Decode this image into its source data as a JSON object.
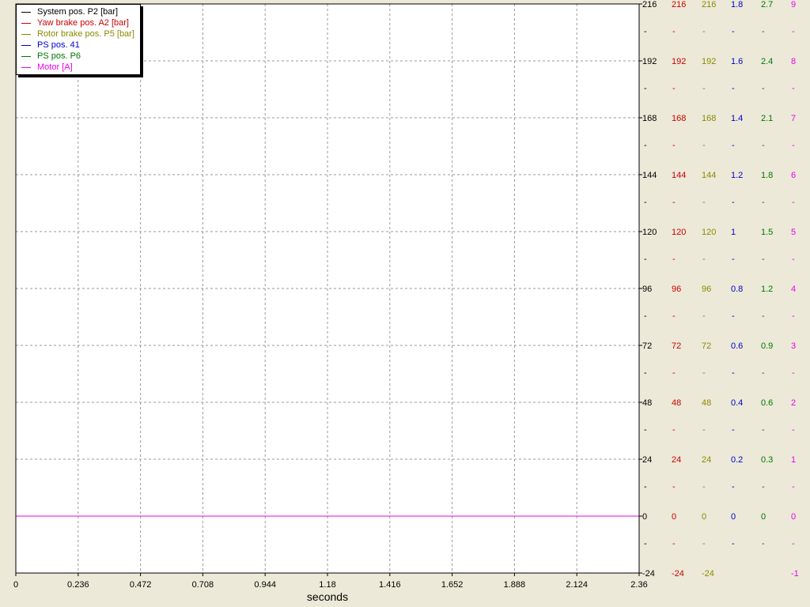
{
  "chart_data": {
    "type": "line",
    "xlabel": "seconds",
    "xlim": [
      0,
      2.36
    ],
    "x_ticks": [
      "0",
      "0.236",
      "0.472",
      "0.708",
      "0.944",
      "1.18",
      "1.416",
      "1.652",
      "1.888",
      "2.124",
      "2.36"
    ],
    "grid": true,
    "legend_position": "top-left",
    "series": [
      {
        "name": "System pos. P2 [bar]",
        "color": "#000000",
        "x": [
          0,
          2.36
        ],
        "values": [
          0,
          0
        ]
      },
      {
        "name": "Yaw brake pos. A2 [bar]",
        "color": "#cc0000",
        "x": [
          0,
          2.36
        ],
        "values": [
          0,
          0
        ]
      },
      {
        "name": "Rotor brake pos. P5 [bar]",
        "color": "#8a8a00",
        "x": [
          0,
          2.36
        ],
        "values": [
          0,
          0
        ]
      },
      {
        "name": "PS pos. 41",
        "color": "#0000cc",
        "x": [
          0,
          2.36
        ],
        "values": [
          0,
          0
        ]
      },
      {
        "name": "PS pos. P6",
        "color": "#007700",
        "x": [
          0,
          2.36
        ],
        "values": [
          0,
          0
        ]
      },
      {
        "name": "Motor [A]",
        "color": "#ee00ee",
        "x": [
          0,
          2.36
        ],
        "values": [
          0,
          0
        ]
      }
    ],
    "y_axes": [
      {
        "color": "#000000",
        "ylim": [
          -24,
          216
        ],
        "ticks": [
          "216",
          "192",
          "168",
          "144",
          "120",
          "96",
          "72",
          "48",
          "24",
          "0",
          "-24"
        ]
      },
      {
        "color": "#cc0000",
        "ylim": [
          -24,
          216
        ],
        "ticks": [
          "216",
          "192",
          "168",
          "144",
          "120",
          "96",
          "72",
          "48",
          "24",
          "0",
          "-24"
        ]
      },
      {
        "color": "#8a8a00",
        "ylim": [
          -24,
          216
        ],
        "ticks": [
          "216",
          "192",
          "168",
          "144",
          "120",
          "96",
          "72",
          "48",
          "24",
          "0",
          "-24"
        ]
      },
      {
        "color": "#0000cc",
        "ylim": [
          -0.2,
          1.8
        ],
        "ticks": [
          "1.8",
          "1.6",
          "1.4",
          "1.2",
          "1",
          "0.8",
          "0.6",
          "0.4",
          "0.2",
          "0",
          ""
        ]
      },
      {
        "color": "#007700",
        "ylim": [
          -0.3,
          2.7
        ],
        "ticks": [
          "2.7",
          "2.4",
          "2.1",
          "1.8",
          "1.5",
          "1.2",
          "0.9",
          "0.6",
          "0.3",
          "0",
          ""
        ]
      },
      {
        "color": "#ee00ee",
        "ylim": [
          -1,
          9
        ],
        "ticks": [
          "9",
          "8",
          "7",
          "6",
          "5",
          "4",
          "3",
          "2",
          "1",
          "0",
          "-1"
        ]
      }
    ]
  }
}
